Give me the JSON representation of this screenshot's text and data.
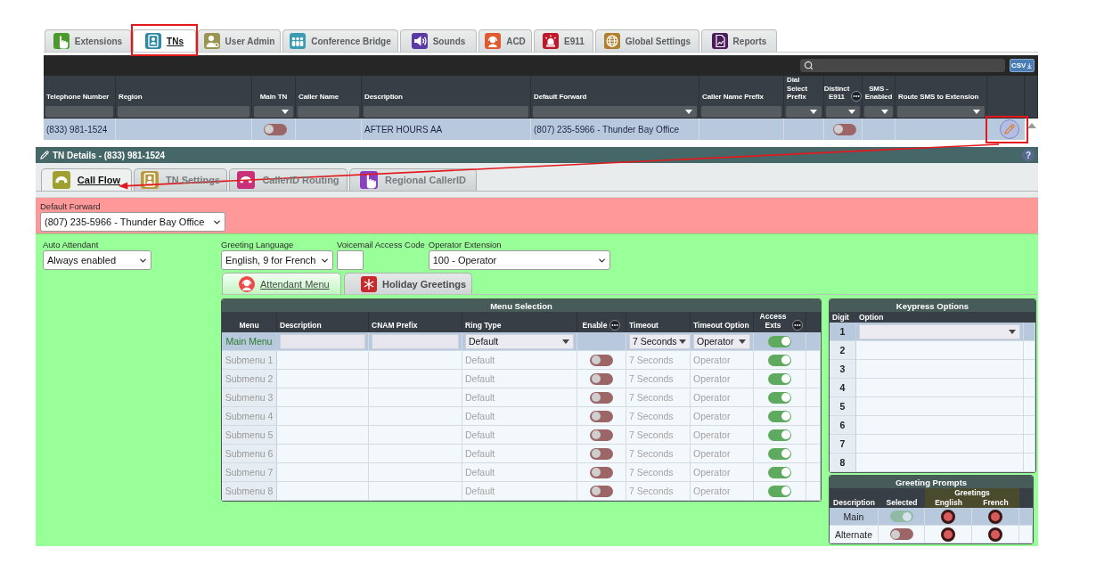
{
  "main_tabs": [
    {
      "label": "Extensions",
      "selected": false
    },
    {
      "label": "TNs",
      "selected": true
    },
    {
      "label": "User Admin",
      "selected": false
    },
    {
      "label": "Conference Bridge",
      "selected": false
    },
    {
      "label": "Sounds",
      "selected": false
    },
    {
      "label": "ACD",
      "selected": false
    },
    {
      "label": "E911",
      "selected": false
    },
    {
      "label": "Global Settings",
      "selected": false
    },
    {
      "label": "Reports",
      "selected": false
    }
  ],
  "tn_table": {
    "csv_button": "CSV",
    "columns": [
      {
        "label": "Telephone Number",
        "kind": "text",
        "options_menu": false
      },
      {
        "label": "Region",
        "kind": "text",
        "options_menu": false
      },
      {
        "label": "Main TN",
        "kind": "toggle",
        "options_menu": false
      },
      {
        "label": "Caller Name",
        "kind": "text",
        "options_menu": false
      },
      {
        "label": "Description",
        "kind": "text",
        "options_menu": false
      },
      {
        "label": "Default Forward",
        "kind": "select",
        "options_menu": false
      },
      {
        "label": "Caller Name Prefix",
        "kind": "text",
        "options_menu": false
      },
      {
        "label": "Dial Select Prefix",
        "kind": "select",
        "options_menu": false
      },
      {
        "label": "Distinct E911",
        "kind": "toggle",
        "options_menu": true
      },
      {
        "label": "SMS -Enabled",
        "kind": "toggle",
        "options_menu": false
      },
      {
        "label": "Route SMS to Extension",
        "kind": "select",
        "options_menu": false
      }
    ],
    "rows": [
      {
        "selected": true,
        "telephone_number": "(833) 981-1524",
        "main_tn": false,
        "description": "AFTER HOURS AA",
        "default_forward": "(807) 235-5966 - Thunder Bay Office",
        "distinct_e911": false
      }
    ]
  },
  "tn_details": {
    "title": "TN Details - (833) 981-1524",
    "help_button": "?",
    "tabs": [
      {
        "label": "Call Flow",
        "selected": true
      },
      {
        "label": "TN Settings",
        "selected": false
      },
      {
        "label": "CallerID Routing",
        "selected": false
      },
      {
        "label": "Regional CallerID",
        "selected": false
      }
    ],
    "default_forward": {
      "label": "Default Forward",
      "value": "(807) 235-5966 - Thunder Bay Office"
    },
    "auto_attendant": {
      "label": "Auto Attendant",
      "value": "Always enabled"
    },
    "settings_fields": [
      {
        "kind": "select",
        "label": "Greeting Language",
        "value": "English, 9 for French"
      },
      {
        "kind": "input",
        "label": "Voicemail Access Code"
      },
      {
        "kind": "select",
        "label": "Operator Extension",
        "value": "100 - Operator"
      }
    ],
    "sub_tabs": [
      {
        "label": "Attendant Menu",
        "selected": true
      },
      {
        "label": "Holiday Greetings",
        "selected": false
      }
    ],
    "menu_selection": {
      "title": "Menu Selection",
      "columns": [
        {
          "label": "Menu",
          "options_menu": false
        },
        {
          "label": "Description",
          "options_menu": false
        },
        {
          "label": "CNAM Prefix",
          "options_menu": false
        },
        {
          "label": "Ring Type",
          "options_menu": false
        },
        {
          "label": "Enable",
          "options_menu": true
        },
        {
          "label": "Timeout",
          "options_menu": false
        },
        {
          "label": "Timeout Option",
          "options_menu": false
        },
        {
          "label": "Access Exts",
          "options_menu": true
        }
      ],
      "rows": [
        {
          "kind": "editable",
          "selected": true,
          "menu": "Main Menu",
          "ring_type": "Default",
          "timeout": "7 Seconds",
          "timeout_option": "Operator",
          "access_exts": true
        },
        {
          "kind": "readonly",
          "selected": false,
          "menu": "Submenu 1",
          "ring_type": "Default",
          "enable": false,
          "timeout": "7 Seconds",
          "timeout_option": "Operator",
          "access_exts": true
        },
        {
          "kind": "readonly",
          "selected": false,
          "menu": "Submenu 2",
          "ring_type": "Default",
          "enable": false,
          "timeout": "7 Seconds",
          "timeout_option": "Operator",
          "access_exts": true
        },
        {
          "kind": "readonly",
          "selected": false,
          "menu": "Submenu 3",
          "ring_type": "Default",
          "enable": false,
          "timeout": "7 Seconds",
          "timeout_option": "Operator",
          "access_exts": true
        },
        {
          "kind": "readonly",
          "selected": false,
          "menu": "Submenu 4",
          "ring_type": "Default",
          "enable": false,
          "timeout": "7 Seconds",
          "timeout_option": "Operator",
          "access_exts": true
        },
        {
          "kind": "readonly",
          "selected": false,
          "menu": "Submenu 5",
          "ring_type": "Default",
          "enable": false,
          "timeout": "7 Seconds",
          "timeout_option": "Operator",
          "access_exts": true
        },
        {
          "kind": "readonly",
          "selected": false,
          "menu": "Submenu 6",
          "ring_type": "Default",
          "enable": false,
          "timeout": "7 Seconds",
          "timeout_option": "Operator",
          "access_exts": true
        },
        {
          "kind": "readonly",
          "selected": false,
          "menu": "Submenu 7",
          "ring_type": "Default",
          "enable": false,
          "timeout": "7 Seconds",
          "timeout_option": "Operator",
          "access_exts": true
        },
        {
          "kind": "readonly",
          "selected": false,
          "menu": "Submenu 8",
          "ring_type": "Default",
          "enable": false,
          "timeout": "7 Seconds",
          "timeout_option": "Operator",
          "access_exts": true
        }
      ]
    },
    "keypress_options": {
      "title": "Keypress Options",
      "columns": [
        "Digit",
        "Option"
      ],
      "rows": [
        {
          "digit": "1",
          "selected": true
        },
        {
          "digit": "2",
          "selected": false
        },
        {
          "digit": "3",
          "selected": false
        },
        {
          "digit": "4",
          "selected": false
        },
        {
          "digit": "5",
          "selected": false
        },
        {
          "digit": "6",
          "selected": false
        },
        {
          "digit": "7",
          "selected": false
        },
        {
          "digit": "8",
          "selected": false
        }
      ]
    },
    "greeting_prompts": {
      "title": "Greeting Prompts",
      "group_label": "Greetings",
      "columns": [
        "Description",
        "Selected",
        "English",
        "French"
      ],
      "rows": [
        {
          "description": "Main",
          "selected": true,
          "on": true,
          "disabled": true
        },
        {
          "description": "Alternate",
          "selected": false,
          "on": false,
          "disabled": false
        }
      ]
    }
  }
}
